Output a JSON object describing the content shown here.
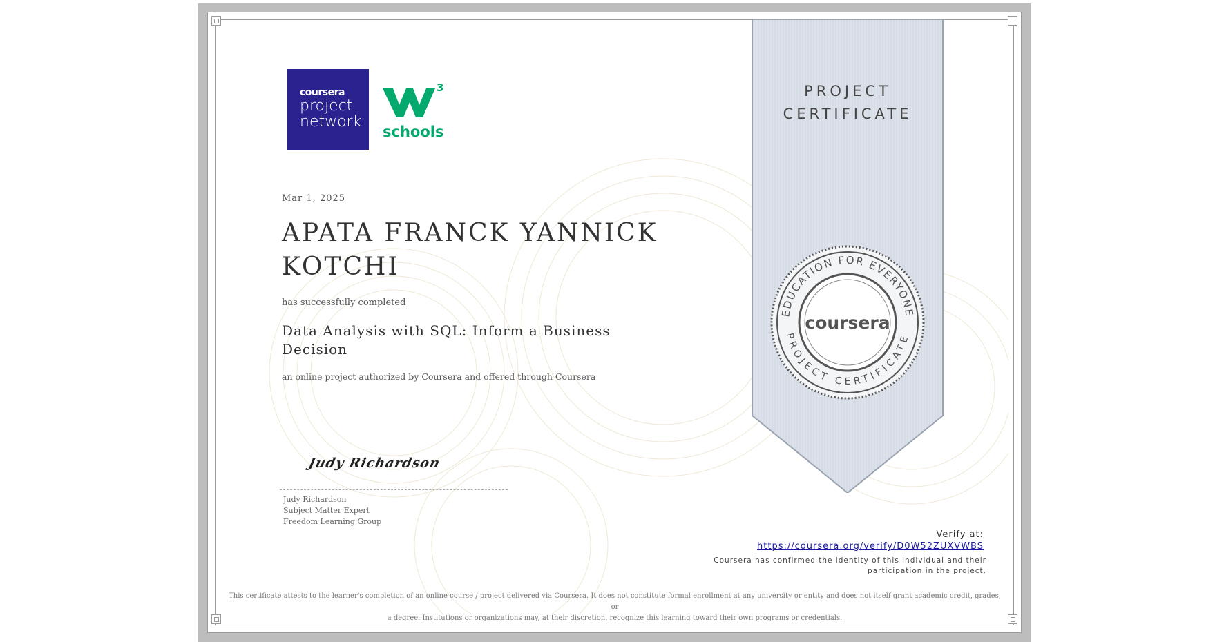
{
  "logos": {
    "coursera_project_network": {
      "brand": "coursera",
      "line1": "project",
      "line2": "network"
    },
    "w3schools": {
      "superscript": "3",
      "word": "schools"
    }
  },
  "certificate": {
    "date": "Mar 1, 2025",
    "name_line1": "APATA FRANCK YANNICK",
    "name_line2": "KOTCHI",
    "completed_text": "has successfully completed",
    "course_line1": "Data Analysis with SQL: Inform a Business",
    "course_line2": "Decision",
    "offered_text": "an online project authorized by Coursera and offered through Coursera"
  },
  "signature": {
    "script": "Judy Richardson",
    "name": "Judy Richardson",
    "title": "Subject Matter Expert",
    "org": "Freedom Learning Group"
  },
  "ribbon": {
    "title_line1": "PROJECT",
    "title_line2": "CERTIFICATE",
    "seal_top_text": "EDUCATION FOR EVERYONE",
    "seal_bottom_text": "PROJECT CERTIFICATE",
    "seal_brand": "coursera"
  },
  "verify": {
    "label": "Verify at:",
    "url": "https://coursera.org/verify/D0W52ZUXVWBS",
    "confirm_line1": "Coursera has confirmed the identity of this individual and their",
    "confirm_line2": "participation in the project."
  },
  "disclaimer": {
    "line1": "This certificate attests to the learner's completion of an online course / project delivered via Coursera. It does not constitute formal enrollment at any university or entity and does not itself grant academic credit, grades, or",
    "line2": "a degree. Institutions or organizations may, at their discretion, recognize this learning toward their own programs or credentials."
  },
  "colors": {
    "coursera_blue": "#2a238f",
    "w3_green": "#04aa6d",
    "ribbon": "#dde2ea",
    "link": "#1a1aa6"
  }
}
